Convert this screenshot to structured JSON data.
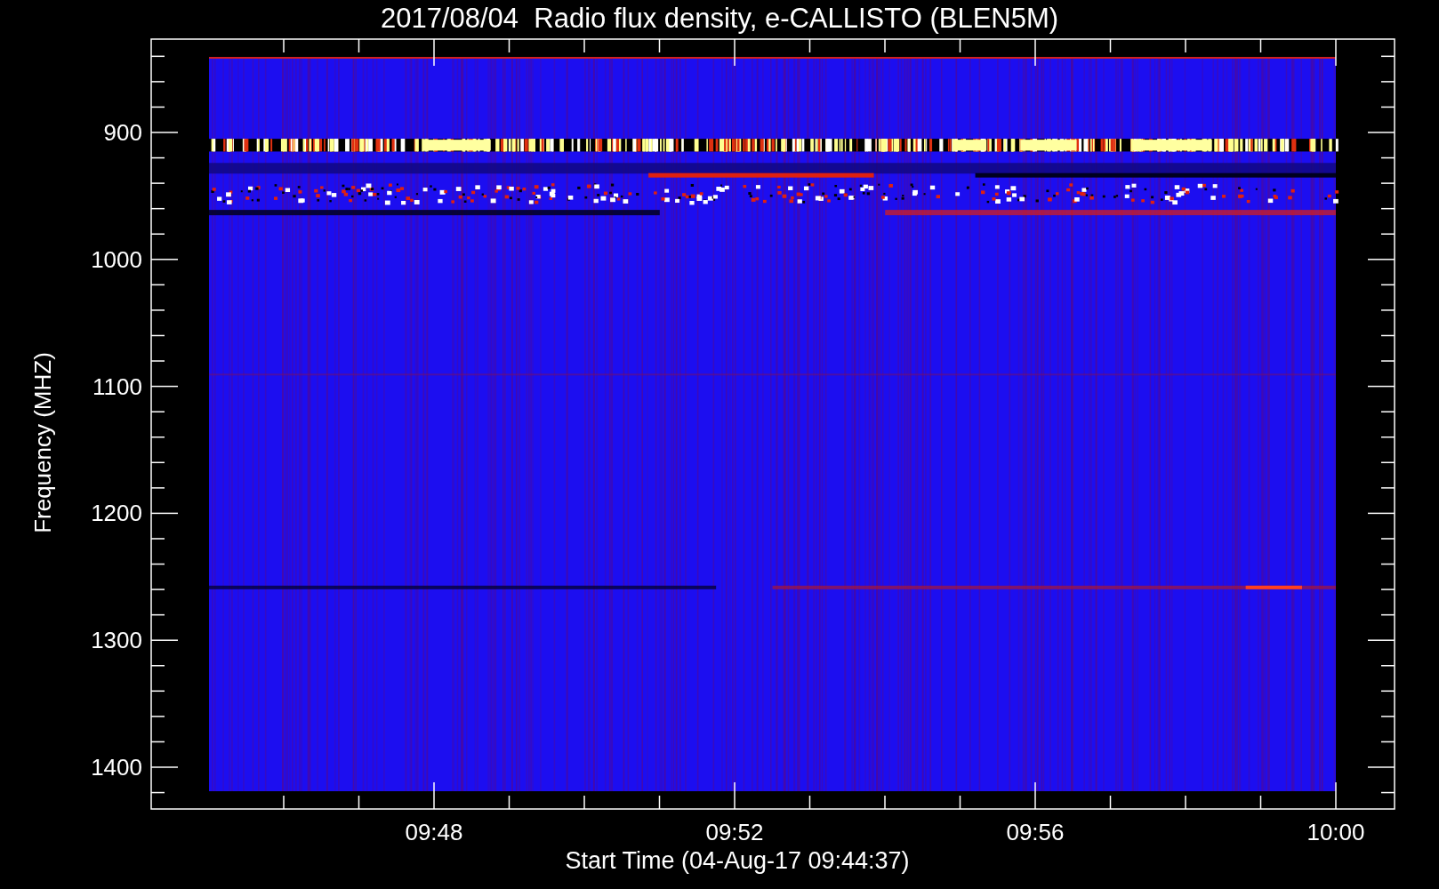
{
  "title": "2017/08/04  Radio flux density, e-CALLISTO (BLEN5M)",
  "y_axis": {
    "label": "Frequency (MHZ)",
    "ticks": [
      "900",
      "1000",
      "1100",
      "1200",
      "1300",
      "1400"
    ]
  },
  "x_axis": {
    "label": "Start Time (04-Aug-17 09:44:37)",
    "ticks": [
      "09:48",
      "09:52",
      "09:56",
      "10:00"
    ]
  }
}
